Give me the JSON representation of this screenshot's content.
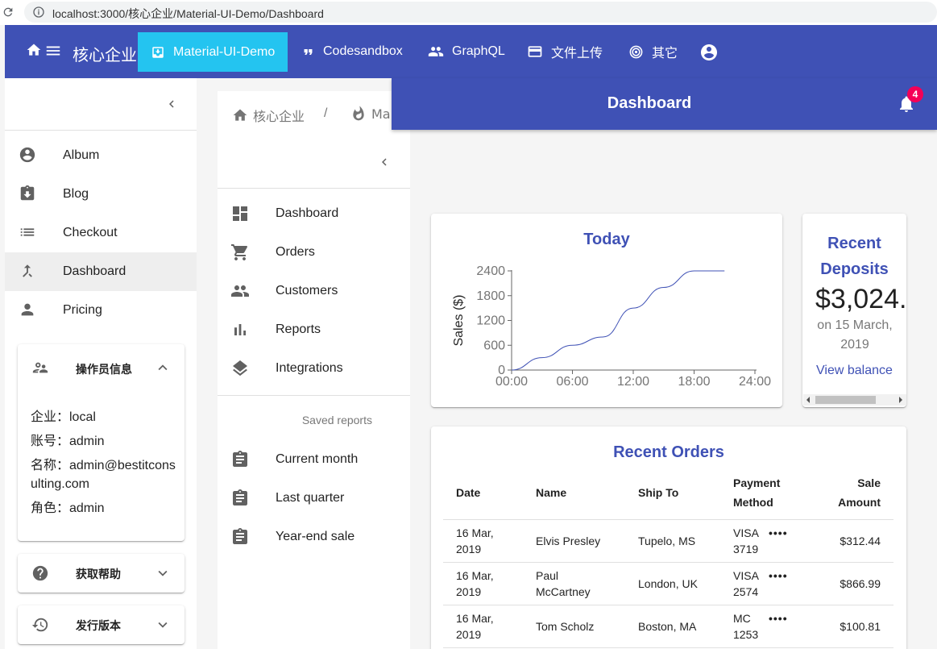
{
  "browser": {
    "url": "localhost:3000/核心企业/Material-UI-Demo/Dashboard"
  },
  "appbar": {
    "brand": "核心企业",
    "nav": [
      {
        "label": "Material-UI-Demo",
        "icon": "ballot-box-icon"
      },
      {
        "label": "Codesandbox",
        "icon": "quote-icon"
      },
      {
        "label": "GraphQL",
        "icon": "people-icon"
      },
      {
        "label": "文件上传",
        "icon": "credit-card-icon"
      },
      {
        "label": "其它",
        "icon": "fingerprint-icon"
      }
    ]
  },
  "sidebar": {
    "items": [
      {
        "label": "Album",
        "icon": "account-circle-icon"
      },
      {
        "label": "Blog",
        "icon": "download-box-icon"
      },
      {
        "label": "Checkout",
        "icon": "list-icon"
      },
      {
        "label": "Dashboard",
        "icon": "merge-arrow-icon"
      },
      {
        "label": "Pricing",
        "icon": "person-icon"
      }
    ],
    "operator_panel": {
      "title": "操作员信息",
      "lines": [
        "企业：local",
        "账号：admin",
        "名称：admin@bestitconsulting.com",
        "角色：admin"
      ]
    },
    "help_panel": {
      "title": "获取帮助"
    },
    "release_panel": {
      "title": "发行版本"
    }
  },
  "breadcrumbs": [
    "核心企业",
    "/",
    "Ma"
  ],
  "subnav": {
    "items": [
      "Dashboard",
      "Orders",
      "Customers",
      "Reports",
      "Integrations"
    ],
    "saved_header": "Saved reports",
    "saved": [
      "Current month",
      "Last quarter",
      "Year-end sale"
    ]
  },
  "dashboard": {
    "title": "Dashboard",
    "notifications": "4",
    "today_title": "Today",
    "deposits": {
      "title_line1": "Recent",
      "title_line2": "Deposits",
      "amount": "$3,024.",
      "date_line1": "on 15 March,",
      "date_line2": "2019",
      "link": "View balance"
    },
    "orders": {
      "title": "Recent Orders",
      "headers": {
        "date": "Date",
        "name": "Name",
        "ship": "Ship To",
        "payment": "Payment Method",
        "amount": "Sale Amount"
      },
      "rows": [
        {
          "date": "16 Mar, 2019",
          "name": "Elvis Presley",
          "ship": "Tupelo, MS",
          "payment": "VISA 3719",
          "amount": "$312.44"
        },
        {
          "date": "16 Mar, 2019",
          "name": "Paul McCartney",
          "ship": "London, UK",
          "payment": "VISA 2574",
          "amount": "$866.99"
        },
        {
          "date": "16 Mar, 2019",
          "name": "Tom Scholz",
          "ship": "Boston, MA",
          "payment": "MC 1253",
          "amount": "$100.81"
        }
      ],
      "more_glyph": "••••"
    }
  },
  "chart_data": {
    "type": "line",
    "title": "Today",
    "xlabel": "",
    "ylabel": "Sales ($)",
    "x": [
      "00:00",
      "03:00",
      "06:00",
      "09:00",
      "12:00",
      "15:00",
      "18:00",
      "21:00"
    ],
    "values": [
      0,
      300,
      600,
      800,
      1500,
      2000,
      2400,
      2400
    ],
    "xticks": [
      "00:00",
      "06:00",
      "12:00",
      "18:00",
      "24:00"
    ],
    "yticks": [
      "0",
      "600",
      "1200",
      "1800",
      "2400"
    ],
    "ylim": [
      0,
      2400
    ],
    "line_color": "#3f51b5"
  },
  "colors": {
    "primary": "#3f51b5",
    "accent_active": "#24c4f0",
    "badge": "#f50057"
  }
}
